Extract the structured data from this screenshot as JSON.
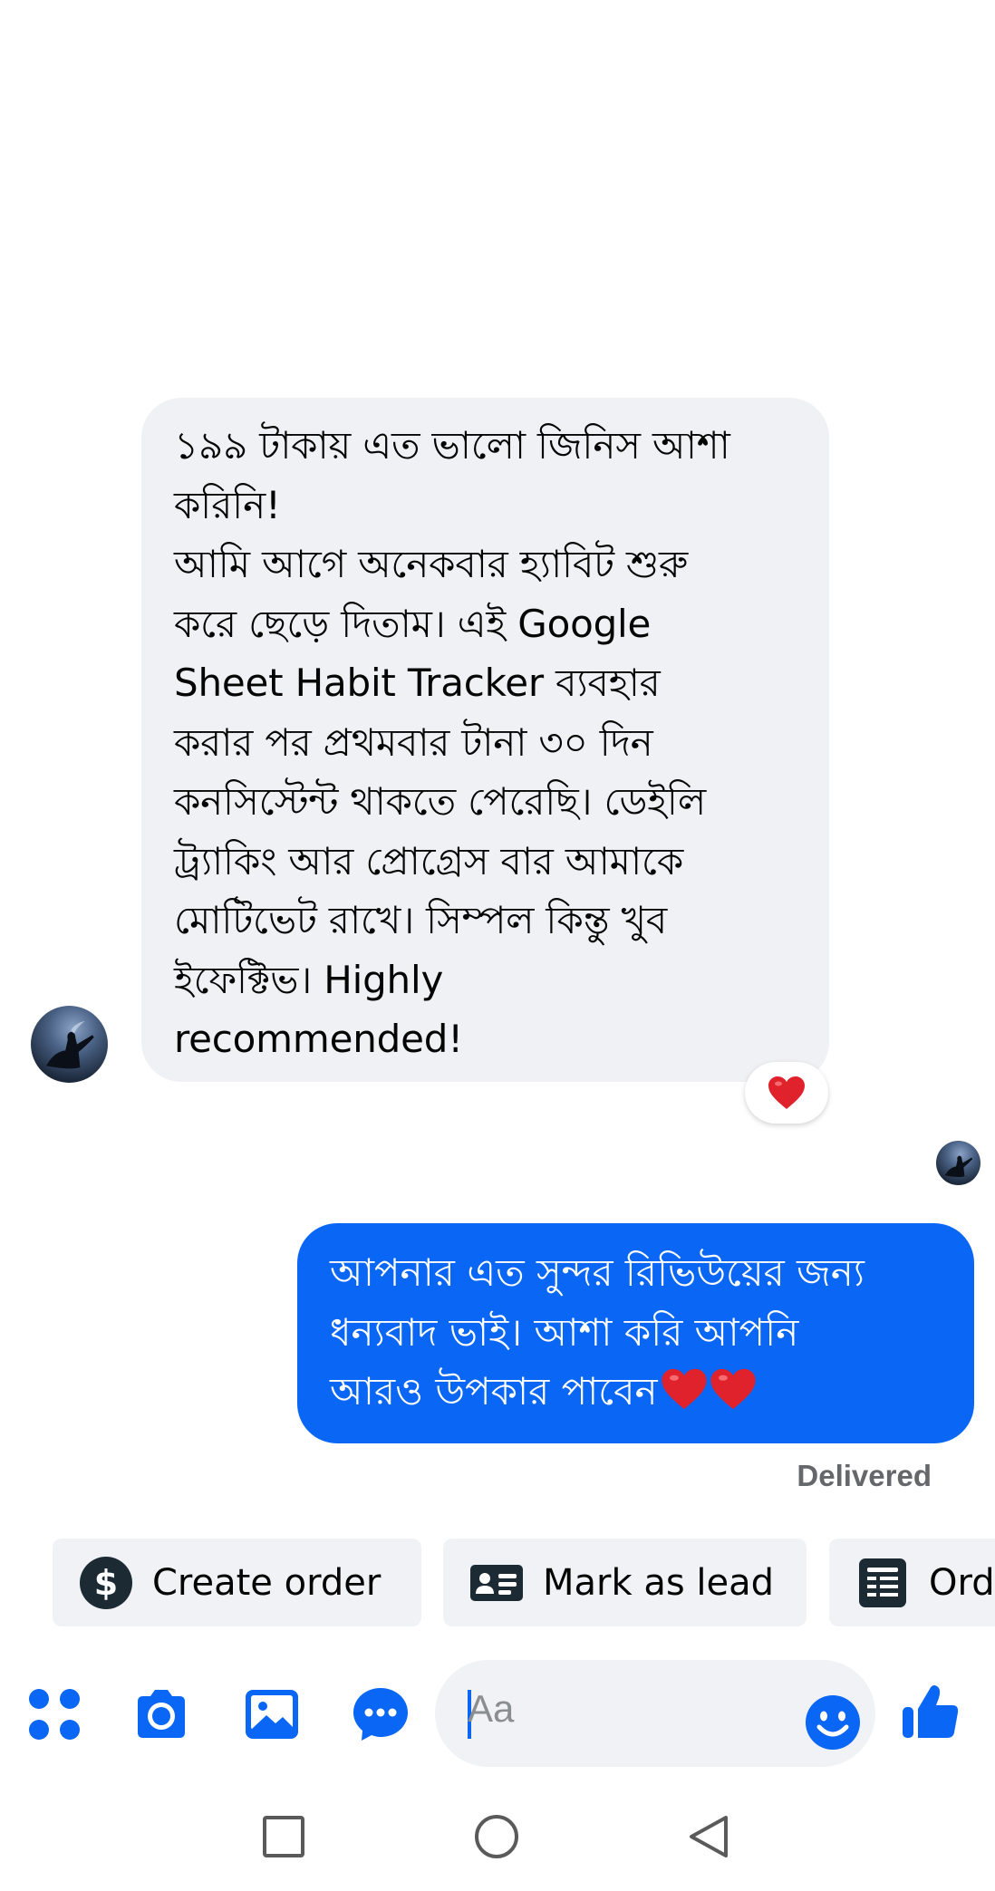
{
  "conversation": {
    "incoming": {
      "lines": [
        "১৯৯ টাকায় এত ভালো জিনিস আশা",
        "করিনি!",
        "আমি আগে অনেকবার হ্যাবিট শুরু",
        "করে ছেড়ে দিতাম। এই Google",
        "Sheet Habit Tracker ব্যবহার",
        "করার পর প্রথমবার টানা ৩০ দিন",
        "কনসিস্টেন্ট থাকতে পেরেছি। ডেইলি",
        "ট্র্যাকিং আর প্রোগ্রেস বার আমাকে",
        "মোটিভেট রাখে। সিম্পল কিন্তু খুব",
        "ইফেক্টিভ। Highly",
        "recommended!"
      ],
      "reaction": "heart"
    },
    "outgoing": {
      "lines": [
        "আপনার এত সুন্দর রিভিউয়ের জন্য",
        "ধন্যবাদ ভাই। আশা করি আপনি",
        "আরও উপকার পাবেন"
      ]
    },
    "status": "Delivered"
  },
  "quick_actions": [
    {
      "label": "Create order",
      "icon": "dollar-circle-icon"
    },
    {
      "label": "Mark as lead",
      "icon": "contact-card-icon"
    },
    {
      "label": "Ord",
      "icon": "order-list-icon"
    }
  ],
  "composer": {
    "placeholder": "Aa",
    "accent": "#0a66f5"
  },
  "colors": {
    "incoming_bubble": "#f0f1f4",
    "outgoing_bubble": "#0a66f5",
    "heart": "#e0222c"
  }
}
